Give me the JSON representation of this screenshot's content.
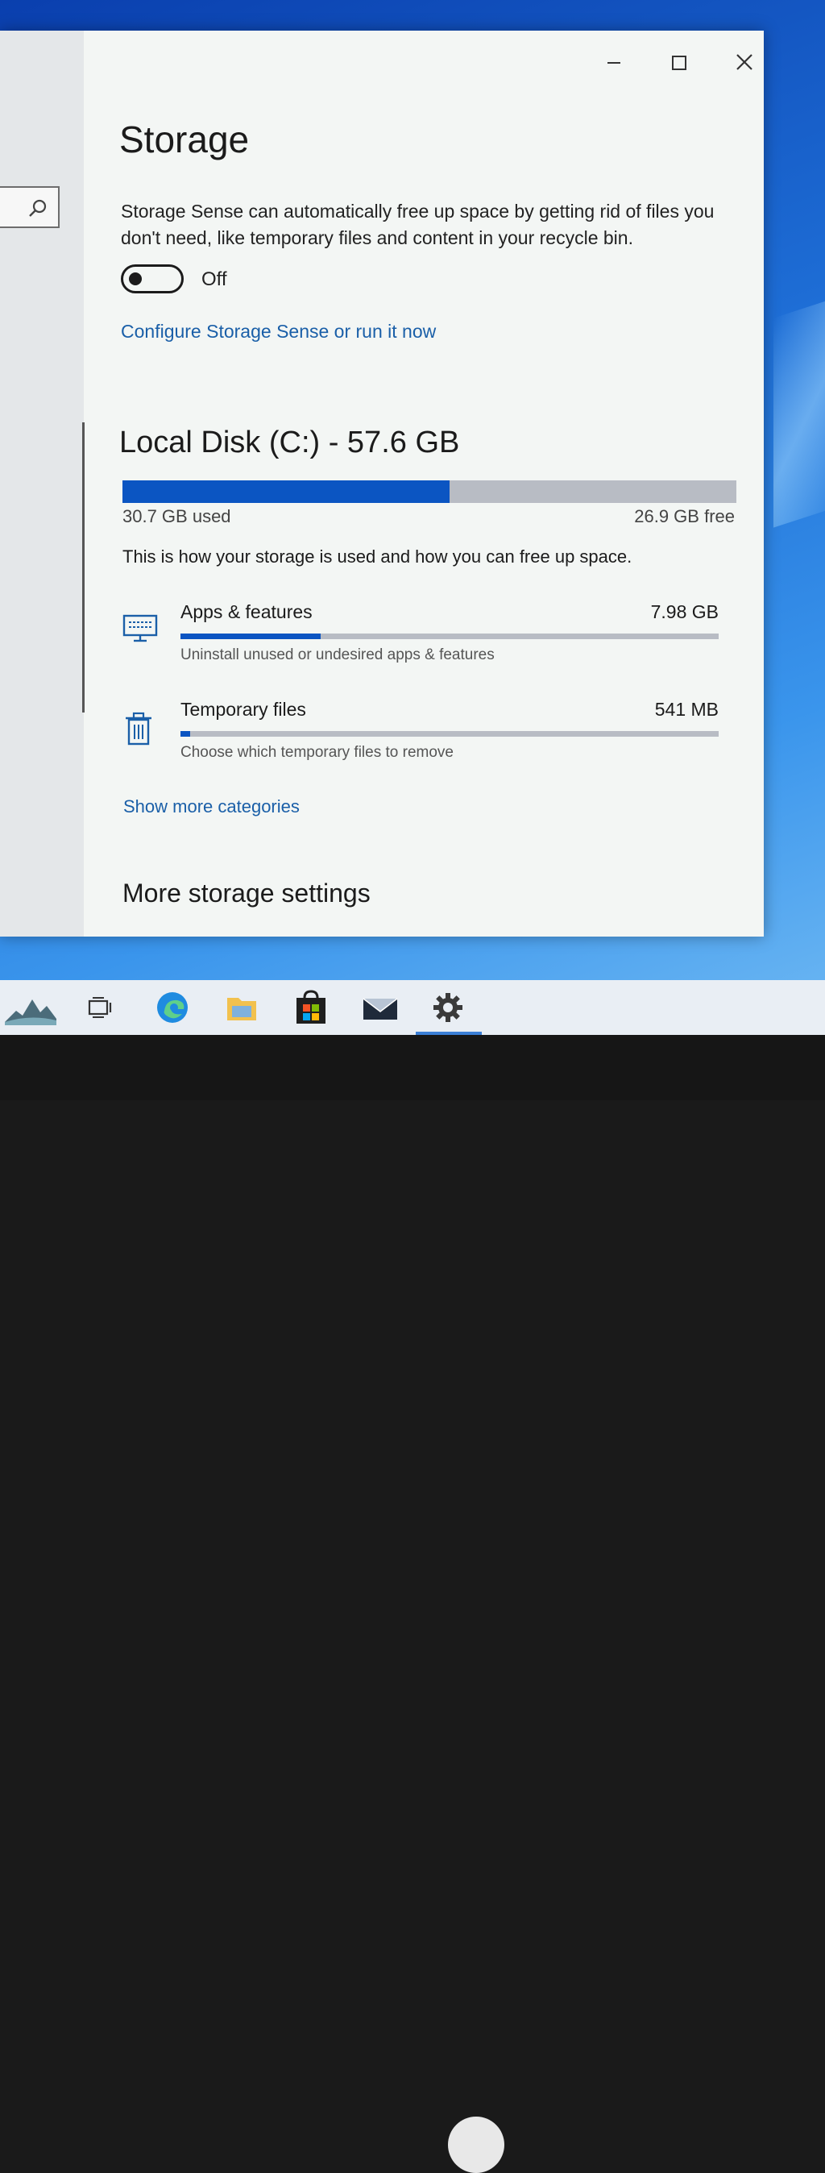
{
  "window": {
    "title": "Storage",
    "controls": {
      "minimize_icon": "minimize-icon",
      "maximize_icon": "maximize-icon",
      "close_icon": "close-icon"
    }
  },
  "sidebar": {
    "search_icon": "search-icon"
  },
  "storage_sense": {
    "description": "Storage Sense can automatically free up space by getting rid of files you don't need, like temporary files and content in your recycle bin.",
    "toggle_state": "Off",
    "configure_link": "Configure Storage Sense or run it now"
  },
  "disk": {
    "title": "Local Disk (C:) - 57.6 GB",
    "used_label": "30.7 GB used",
    "free_label": "26.9 GB free",
    "used_fraction": 0.533,
    "usage_note": "This is how your storage is used and how you can free up space."
  },
  "categories": [
    {
      "name": "Apps & features",
      "size": "7.98 GB",
      "subtitle": "Uninstall unused or undesired apps & features",
      "fraction": 0.26,
      "icon": "monitor-icon"
    },
    {
      "name": "Temporary files",
      "size": "541 MB",
      "subtitle": "Choose which temporary files to remove",
      "fraction": 0.018,
      "icon": "trash-icon"
    }
  ],
  "show_more_link": "Show more categories",
  "more_settings_heading": "More storage settings",
  "taskbar": {
    "items": [
      "landscape-icon",
      "task-view-icon",
      "edge-icon",
      "file-explorer-icon",
      "store-icon",
      "mail-icon",
      "settings-icon"
    ],
    "active": "settings-icon"
  },
  "colors": {
    "accent": "#0b55c2",
    "link": "#1a5fa8",
    "track": "#b8bcc4"
  }
}
